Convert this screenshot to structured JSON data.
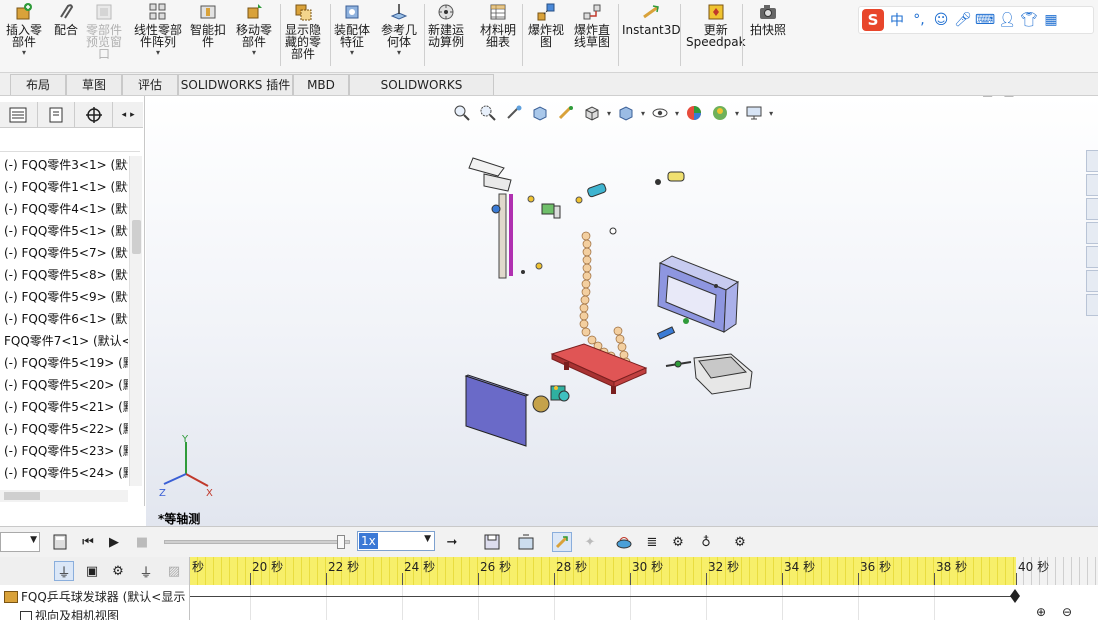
{
  "ribbon": {
    "buttons": [
      {
        "label": "插入零\n部件",
        "icon": "insert-component-icon",
        "enabled": true
      },
      {
        "label": "配合",
        "icon": "mate-icon",
        "enabled": true
      },
      {
        "label": "零部件\n预览窗\n口",
        "icon": "component-preview-icon",
        "enabled": false
      },
      {
        "label": "线性零部\n件阵列",
        "icon": "linear-pattern-icon",
        "enabled": true
      },
      {
        "label": "智能扣\n件",
        "icon": "smart-fasteners-icon",
        "enabled": true
      },
      {
        "label": "移动零\n部件",
        "icon": "move-component-icon",
        "enabled": true
      },
      {
        "label": "显示隐\n藏的零\n部件",
        "icon": "show-hidden-icon",
        "enabled": true
      },
      {
        "label": "装配体\n特征",
        "icon": "assembly-features-icon",
        "enabled": true
      },
      {
        "label": "参考几\n何体",
        "icon": "reference-geometry-icon",
        "enabled": true
      },
      {
        "label": "新建运\n动算例",
        "icon": "new-motion-study-icon",
        "enabled": true
      },
      {
        "label": "材料明\n细表",
        "icon": "bom-icon",
        "enabled": true
      },
      {
        "label": "爆炸视\n图",
        "icon": "exploded-view-icon",
        "enabled": true
      },
      {
        "label": "爆炸直\n线草图",
        "icon": "explode-line-sketch-icon",
        "enabled": true
      },
      {
        "label": "Instant3D",
        "icon": "instant3d-icon",
        "enabled": true
      },
      {
        "label": "更新\nSpeedpak",
        "icon": "speedpak-icon",
        "enabled": true
      },
      {
        "label": "拍快照",
        "icon": "snapshot-icon",
        "enabled": true
      }
    ]
  },
  "ime": {
    "logo": "S",
    "mode": "中",
    "punct": "°,"
  },
  "tabs": [
    "布局",
    "草图",
    "评估",
    "SOLIDWORKS 插件",
    "MBD",
    "SOLIDWORKS Inspection"
  ],
  "tree": {
    "items": [
      "(-) FQQ零件3<1> (默认",
      "(-) FQQ零件1<1> (默认",
      "(-) FQQ零件4<1> (默认",
      "(-) FQQ零件5<1> (默认",
      "(-) FQQ零件5<7> (默认",
      "(-) FQQ零件5<8> (默认",
      "(-) FQQ零件5<9> (默认",
      "(-) FQQ零件6<1> (默认",
      "FQQ零件7<1> (默认<",
      "(-) FQQ零件5<19> (默",
      "(-) FQQ零件5<20> (默",
      "(-) FQQ零件5<21> (默",
      "(-) FQQ零件5<22> (默",
      "(-) FQQ零件5<23> (默",
      "(-) FQQ零件5<24> (默"
    ]
  },
  "viewport": {
    "view_name": "*等轴测",
    "triad": {
      "x": "X",
      "y": "Y",
      "z": "Z"
    }
  },
  "motion": {
    "playback_speed": "1x",
    "ticks": [
      "20 秒",
      "22 秒",
      "24 秒",
      "26 秒",
      "28 秒",
      "30 秒",
      "32 秒",
      "34 秒",
      "36 秒",
      "38 秒",
      "40 秒"
    ],
    "tree": {
      "root": "FQQ乒乓球发球器 (默认<显示",
      "child": "视向及相机视图"
    }
  },
  "colors": {
    "timeline_active": "#f7ef6a",
    "selection": "#3b79d6",
    "ime_logo": "#e8462b"
  }
}
